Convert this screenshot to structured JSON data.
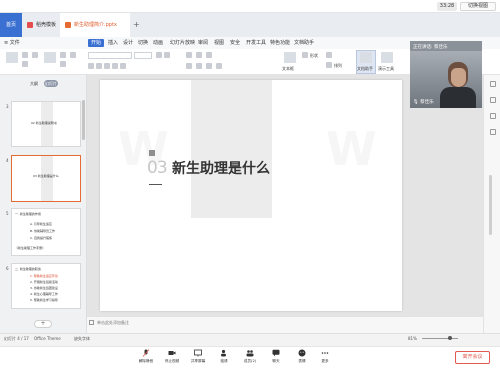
{
  "meeting": {
    "time": "33:28",
    "switch_view": "切换视图",
    "speaker_label": "正在讲话: 蔡佳乐",
    "participant_name": "蔡佳乐",
    "controls": [
      {
        "label": "解除静音",
        "icon": "mic-muted-icon"
      },
      {
        "label": "停止视频",
        "icon": "camera-icon"
      },
      {
        "label": "共享屏幕",
        "icon": "share-screen-icon"
      },
      {
        "label": "邀请",
        "icon": "invite-icon"
      },
      {
        "label": "成员(2)",
        "icon": "members-icon"
      },
      {
        "label": "聊天",
        "icon": "chat-icon"
      },
      {
        "label": "表情",
        "icon": "emoji-icon"
      },
      {
        "label": "更多",
        "icon": "more-icon"
      }
    ],
    "leave_label": "离开会议"
  },
  "wps": {
    "home_tab": "首页",
    "tabs": [
      {
        "label": "稻壳模板"
      },
      {
        "label": "新生助理简介.pptx"
      }
    ],
    "file_menu": "≡ 文件",
    "ribbon_tabs": [
      "开始",
      "插入",
      "设计",
      "切换",
      "动画",
      "幻灯片放映",
      "审阅",
      "视图",
      "安全",
      "开发工具",
      "特色功能",
      "文档助手"
    ],
    "active_ribbon_tab": "开始",
    "toolbar_labels": [
      "文本框",
      "形状",
      "排列",
      "文档助手",
      "演示工具"
    ],
    "panel_tabs": {
      "outline": "大纲",
      "slides": "幻灯片"
    },
    "thumbnails": [
      {
        "num": "3",
        "lines": [
          "02 新生助理说明书",
          "—"
        ]
      },
      {
        "num": "4",
        "lines": [
          "03 新生助理是什么",
          "—"
        ]
      },
      {
        "num": "5",
        "lines": [
          "一. 新生助理的作用",
          "A. 引导新生适应",
          "B. 协助辅导员工作",
          "C. 自我提升锻炼",
          "《新生助理工作手册》"
        ]
      },
      {
        "num": "6",
        "lines": [
          "二. 新生助理的职责",
          "1. 帮助新生适应环境",
          "2. 开展新生班级活动",
          "3. 协助新生班团建设",
          "4. 新生心理辅导工作",
          "5. 帮助新生学习指导"
        ]
      }
    ],
    "slide": {
      "number": "03",
      "title": "新生助理是什么"
    },
    "notes_placeholder": "单击此处添加备注",
    "status": {
      "slide_info": "幻灯片 4 / 17",
      "theme": "Office Theme",
      "font_missing": "缺失字体",
      "zoom": "81%"
    }
  }
}
